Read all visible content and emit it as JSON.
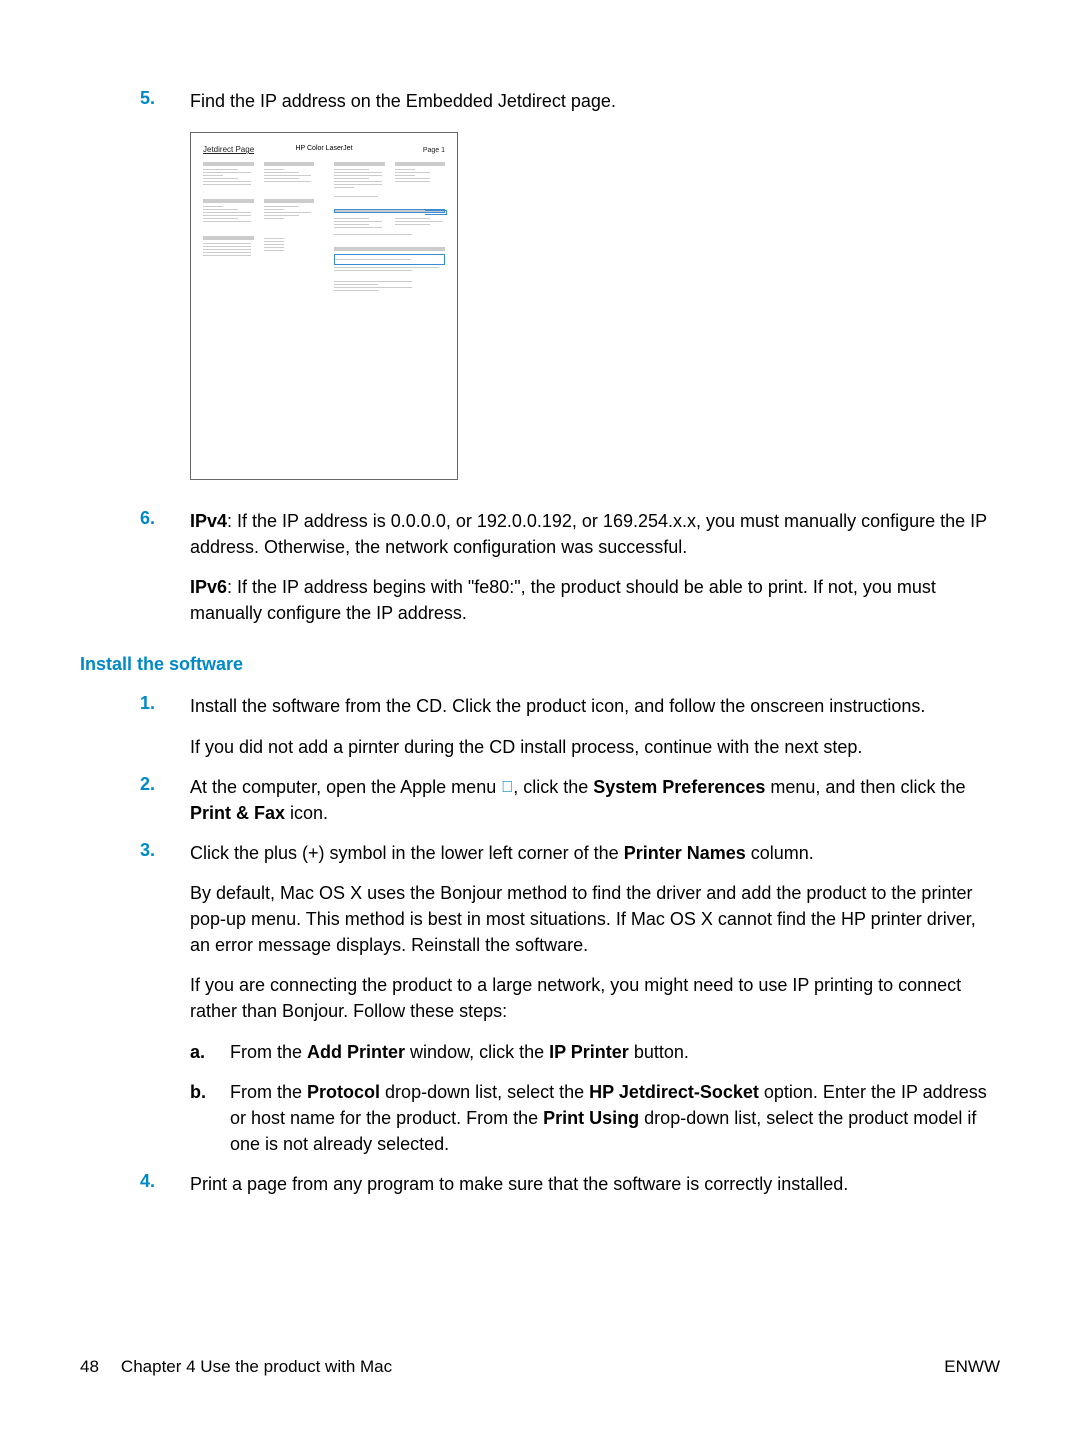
{
  "steps": {
    "s5": {
      "num": "5.",
      "text": "Find the IP address on the Embedded Jetdirect page."
    },
    "s6": {
      "num": "6.",
      "ipv4_label": "IPv4",
      "ipv4_text": ": If the IP address is 0.0.0.0, or 192.0.0.192, or 169.254.x.x, you must manually configure the IP address. Otherwise, the network configuration was successful.",
      "ipv6_label": "IPv6",
      "ipv6_text": ": If the IP address begins with \"fe80:\", the product should be able to print. If not, you must manually configure the IP address."
    }
  },
  "section_heading": "Install the software",
  "sw": {
    "s1": {
      "num": "1.",
      "text": "Install the software from the CD. Click the product icon, and follow the onscreen instructions.",
      "note": "If you did not add a pirnter during the CD install process, continue with the next step."
    },
    "s2": {
      "num": "2.",
      "pre": "At the computer, open the Apple menu ",
      "mid": ", click the ",
      "sys_pref": "System Preferences",
      "mid2": " menu, and then click the ",
      "print_fax": "Print & Fax",
      "end": " icon."
    },
    "s3": {
      "num": "3.",
      "line1a": "Click the plus (+) symbol in the lower left corner of the ",
      "printer_names": "Printer Names",
      "line1b": " column.",
      "para2": "By default, Mac OS X uses the Bonjour method to find the driver and add the product to the printer pop-up menu. This method is best in most situations. If Mac OS X cannot find the HP printer driver, an error message displays. Reinstall the software.",
      "para3": "If you are connecting the product to a large network, you might need to use IP printing to connect rather than Bonjour. Follow these steps:",
      "a": {
        "letter": "a.",
        "pre": "From the ",
        "add_printer": "Add Printer",
        "mid": " window, click the ",
        "ip_printer": "IP Printer",
        "end": " button."
      },
      "b": {
        "letter": "b.",
        "pre": "From the ",
        "protocol": "Protocol",
        "mid1": " drop-down list, select the ",
        "jetdirect": "HP Jetdirect-Socket",
        "mid2": " option. Enter the IP address or host name for the product. From the ",
        "print_using": "Print Using",
        "end": " drop-down list, select the product model if one is not already selected."
      }
    },
    "s4": {
      "num": "4.",
      "text": "Print a page from any program to make sure that the software is correctly installed."
    }
  },
  "jetdirect": {
    "title": "Jetdirect Page",
    "center": "HP Color LaserJet",
    "page": "Page 1"
  },
  "footer": {
    "page_num": "48",
    "chapter": "Chapter 4   Use the product with Mac",
    "right": "ENWW"
  }
}
